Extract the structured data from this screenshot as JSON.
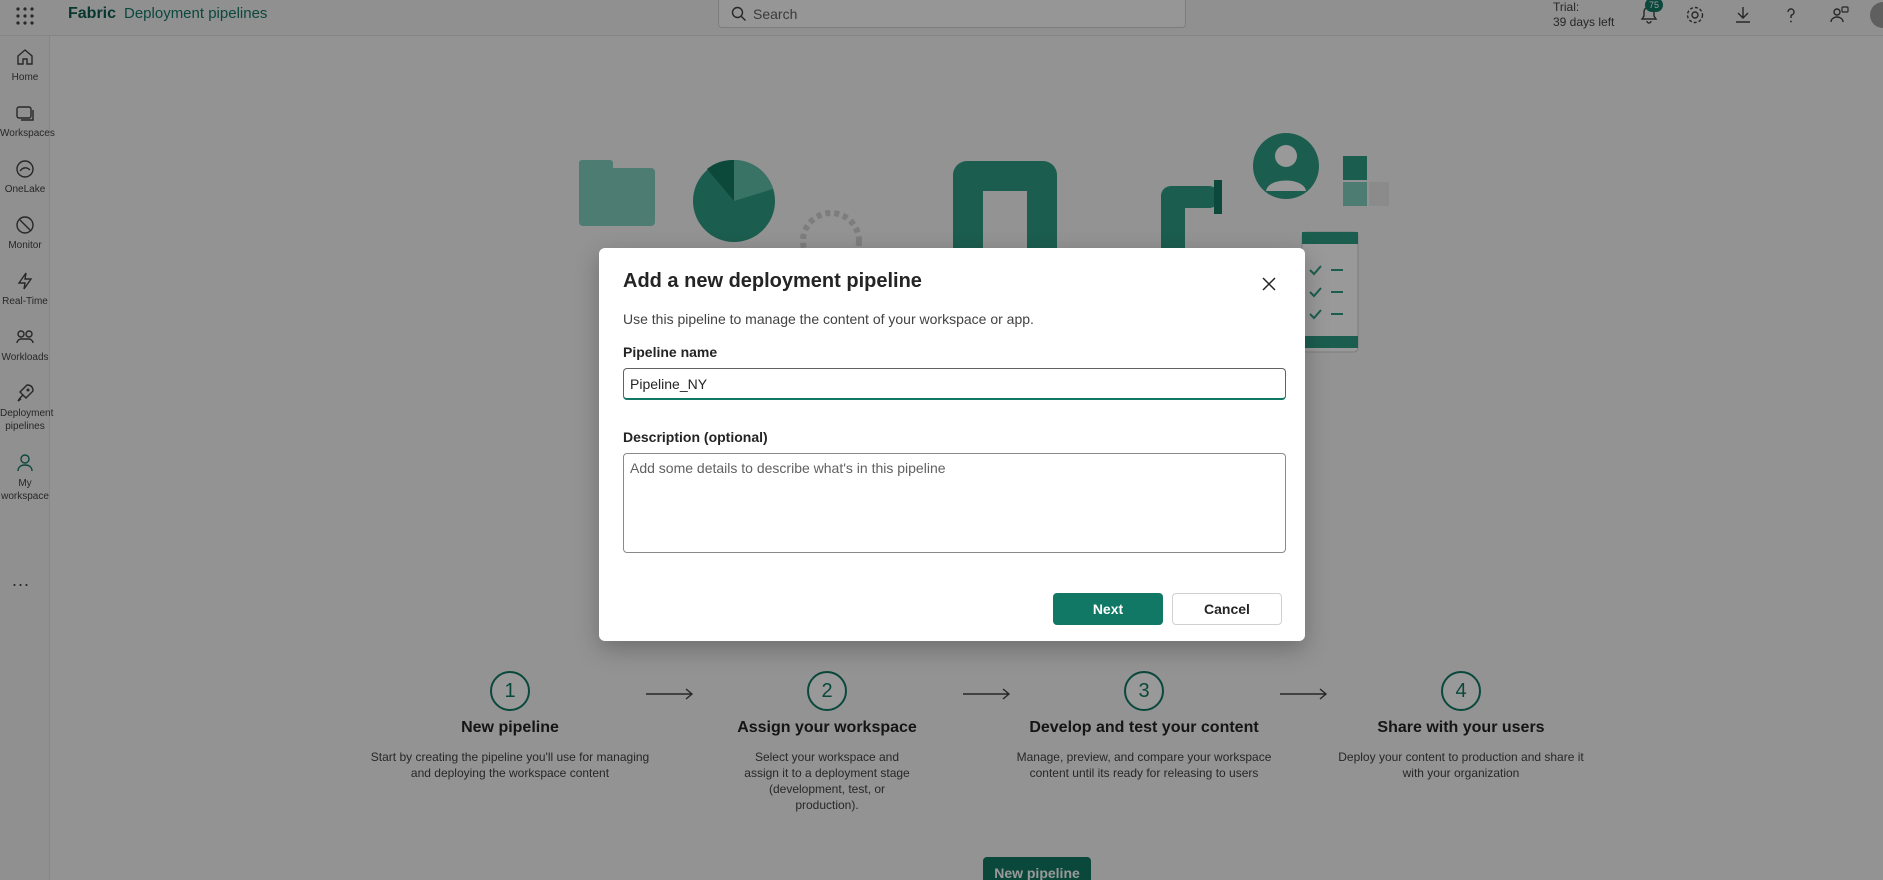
{
  "header": {
    "brand": "Fabric",
    "breadcrumb": "Deployment pipelines",
    "search_placeholder": "Search",
    "trial_line1": "Trial:",
    "trial_line2": "39 days left",
    "notification_count": "75",
    "icons": [
      "app-launcher-icon",
      "bell-icon",
      "gear-icon",
      "download-icon",
      "help-icon",
      "share-feedback-icon"
    ]
  },
  "sidebar": {
    "items": [
      {
        "label": "Home",
        "icon": "home-icon"
      },
      {
        "label": "Workspaces",
        "icon": "workspaces-icon"
      },
      {
        "label": "OneLake",
        "icon": "onelake-icon"
      },
      {
        "label": "Monitor",
        "icon": "monitor-icon"
      },
      {
        "label": "Real-Time",
        "icon": "lightning-icon"
      },
      {
        "label": "Workloads",
        "icon": "workloads-icon"
      },
      {
        "label": "Deployment pipelines",
        "icon": "rocket-icon"
      },
      {
        "label": "My workspace",
        "icon": "person-icon"
      }
    ],
    "more": "..."
  },
  "steps": [
    {
      "number": "1",
      "title": "New pipeline",
      "desc": "Start by creating the pipeline you'll use for managing and deploying the workspace content"
    },
    {
      "number": "2",
      "title": "Assign your workspace",
      "desc": "Select your workspace and assign it to a deployment stage (development, test, or production)."
    },
    {
      "number": "3",
      "title": "Develop and test your content",
      "desc": "Manage, preview, and compare your workspace content until its ready for releasing to users"
    },
    {
      "number": "4",
      "title": "Share with your users",
      "desc": "Deploy your content to production and share it with your organization"
    }
  ],
  "cta_label": "New pipeline",
  "dialog": {
    "title": "Add a new deployment pipeline",
    "subtitle": "Use this pipeline to manage the content of your workspace or app.",
    "name_label": "Pipeline name",
    "name_value": "Pipeline_NY",
    "description_label": "Description (optional)",
    "description_placeholder": "Add some details to describe what's in this pipeline",
    "next_label": "Next",
    "cancel_label": "Cancel"
  },
  "colors": {
    "accent": "#117865",
    "brand": "#0e5c4d",
    "overlay": "rgba(0,0,0,0.4)"
  }
}
